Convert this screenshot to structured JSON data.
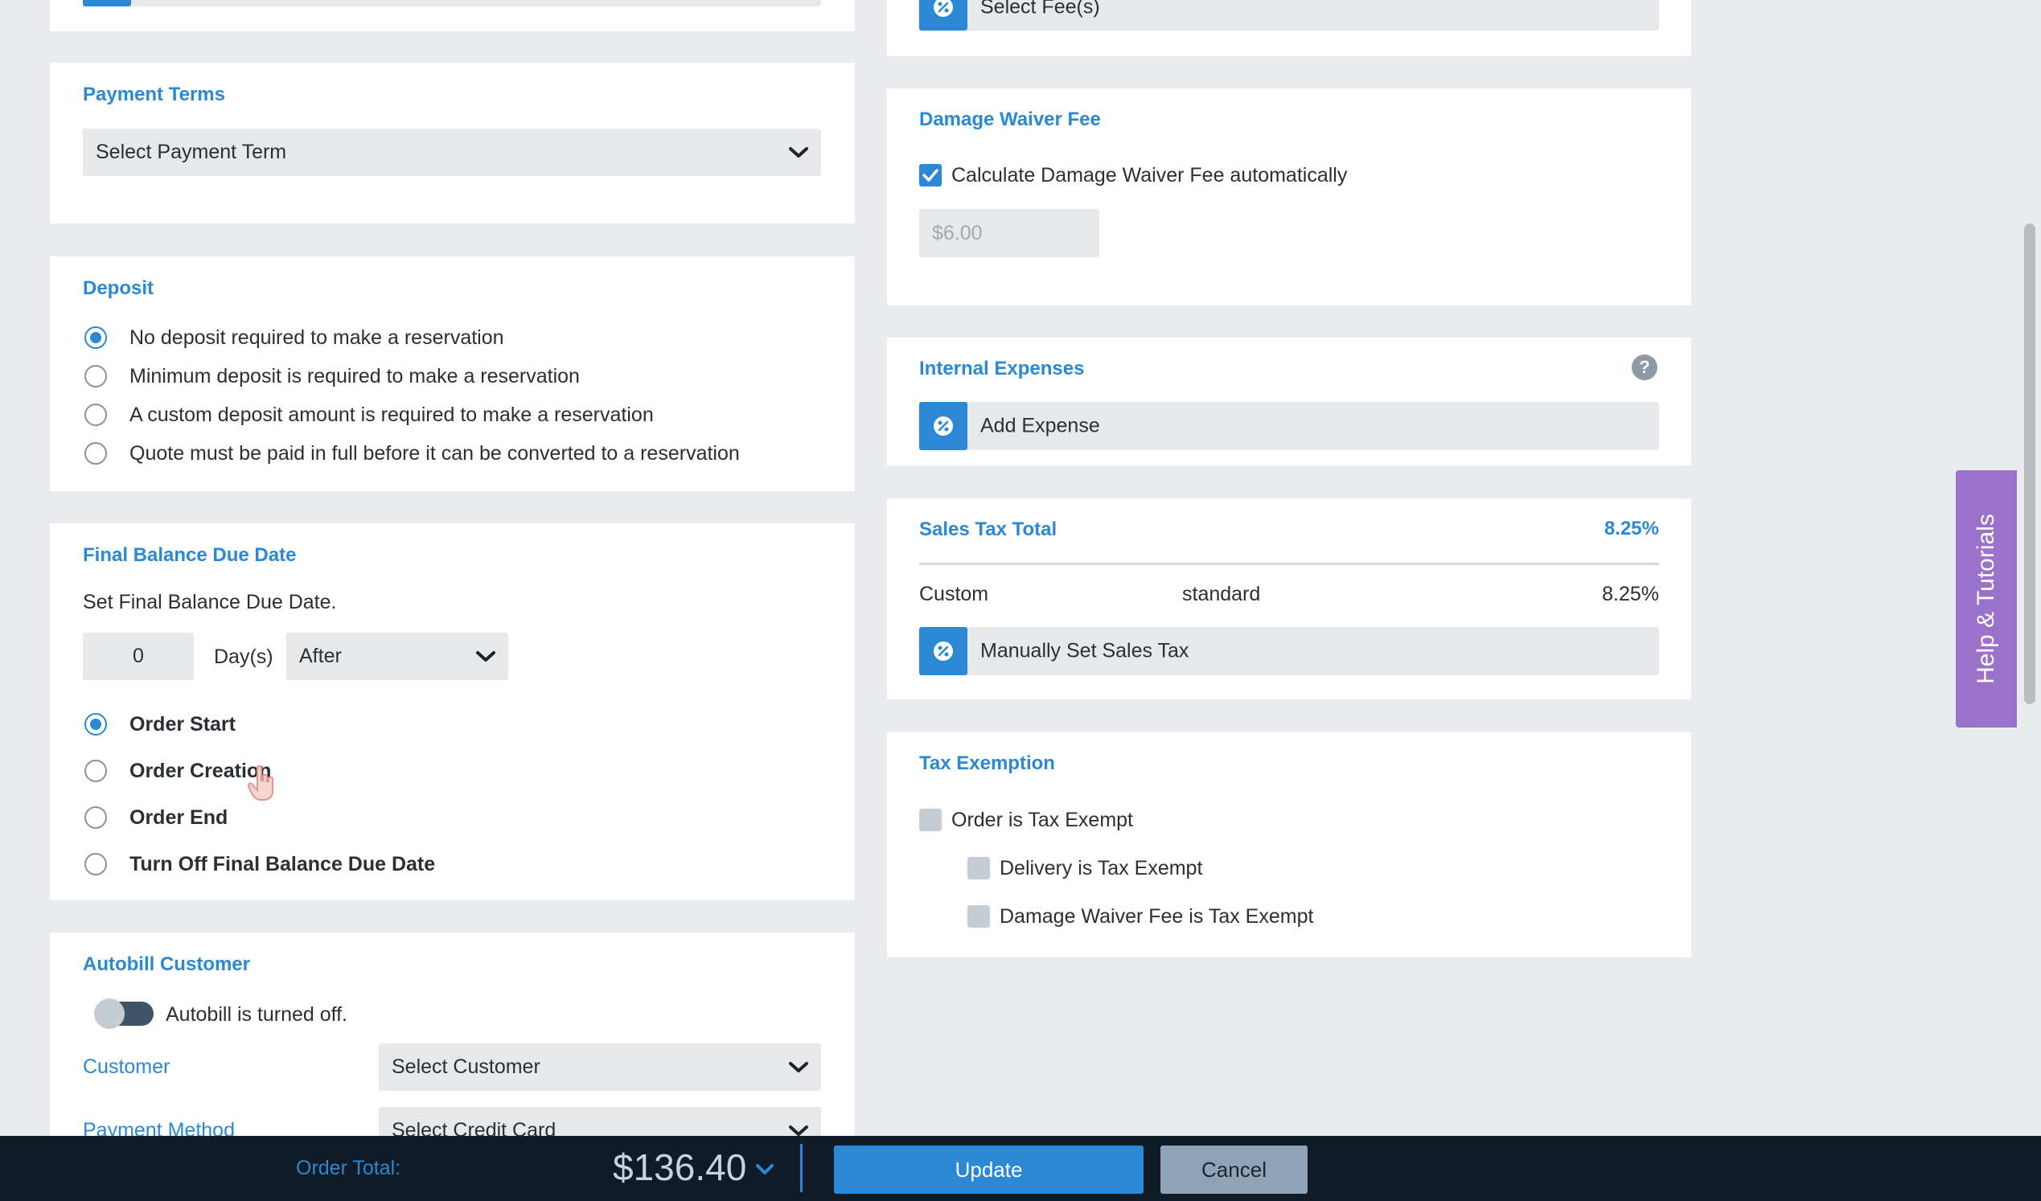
{
  "left": {
    "top_partial_select": "",
    "payment_terms": {
      "title": "Payment Terms",
      "select": "Select Payment Term"
    },
    "deposit": {
      "title": "Deposit",
      "options": [
        "No deposit required to make a reservation",
        "Minimum deposit is required to make a reservation",
        "A custom deposit amount is required to make a reservation",
        "Quote must be paid in full before it can be converted to a reservation"
      ],
      "selected_index": 0
    },
    "final_balance": {
      "title": "Final Balance Due Date",
      "description": "Set Final Balance Due Date.",
      "days_value": "0",
      "days_label": "Day(s)",
      "relation_select": "After",
      "options": [
        "Order Start",
        "Order Creation",
        "Order End",
        "Turn Off Final Balance Due Date"
      ],
      "selected_index": 0
    },
    "autobill": {
      "title": "Autobill Customer",
      "toggle_label": "Autobill is turned off.",
      "customer_label": "Customer",
      "customer_select": "Select Customer",
      "payment_label": "Payment Method",
      "payment_select": "Select Credit Card"
    }
  },
  "right": {
    "fees": {
      "select_label": "Select Fee(s)"
    },
    "damage_waiver": {
      "title": "Damage Waiver Fee",
      "checkbox_label": "Calculate Damage Waiver Fee automatically",
      "checked": true,
      "amount": "$6.00"
    },
    "internal_expenses": {
      "title": "Internal Expenses",
      "help_symbol": "?",
      "action_label": "Add Expense"
    },
    "sales_tax": {
      "title": "Sales Tax Total",
      "total_rate": "8.25%",
      "row": {
        "name": "Custom",
        "type": "standard",
        "rate": "8.25%"
      },
      "action_label": "Manually Set Sales Tax"
    },
    "tax_exemption": {
      "title": "Tax Exemption",
      "items": [
        "Order is Tax Exempt",
        "Delivery is Tax Exempt",
        "Damage Waiver Fee is Tax Exempt"
      ]
    }
  },
  "help_tab": "Help & Tutorials",
  "footer": {
    "order_total_label": "Order Total:",
    "order_total_value": "$136.40",
    "update_label": "Update",
    "cancel_label": "Cancel"
  },
  "colors": {
    "accent": "#2a88d4",
    "footer_bg": "#0f1b27",
    "help_tab": "#9b71c9",
    "cancel_bg": "#8ea2b8"
  },
  "icons": {
    "select_chevron": "chevron-down-icon",
    "action_icon": "percent-badge-icon",
    "help": "question-circle-icon",
    "cursor": "hand-cursor-icon"
  }
}
